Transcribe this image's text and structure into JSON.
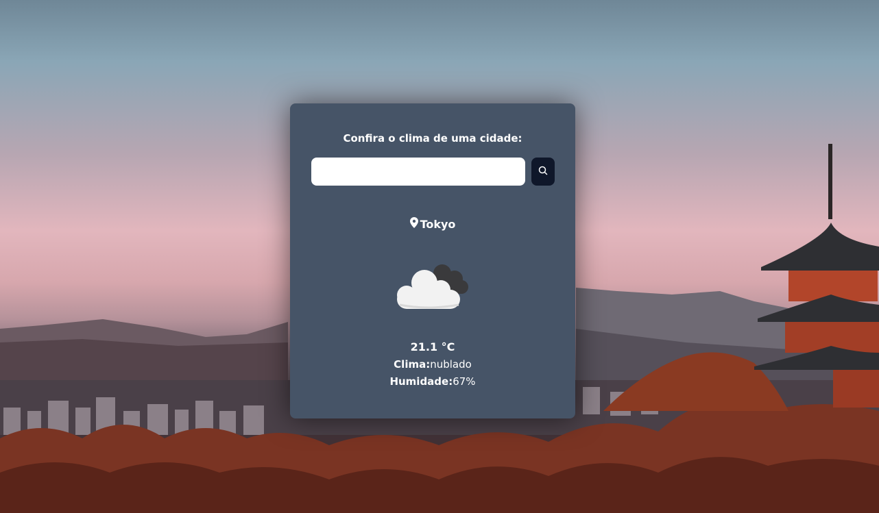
{
  "card": {
    "title": "Confira o clima de uma cidade:",
    "search": {
      "value": "",
      "placeholder": "",
      "button_icon": "search-icon"
    },
    "city": {
      "icon": "map-pin-icon",
      "name": "Tokyo"
    },
    "weather": {
      "icon": "cloudy-icon",
      "temperature": "21.1 °C",
      "description_label": "Clima:",
      "description_value": "nublado",
      "humidity_label": "Humidade:",
      "humidity_value": "67%"
    }
  },
  "colors": {
    "card_bg": "#465467",
    "button_bg": "#0f172a",
    "text": "#ffffff"
  }
}
